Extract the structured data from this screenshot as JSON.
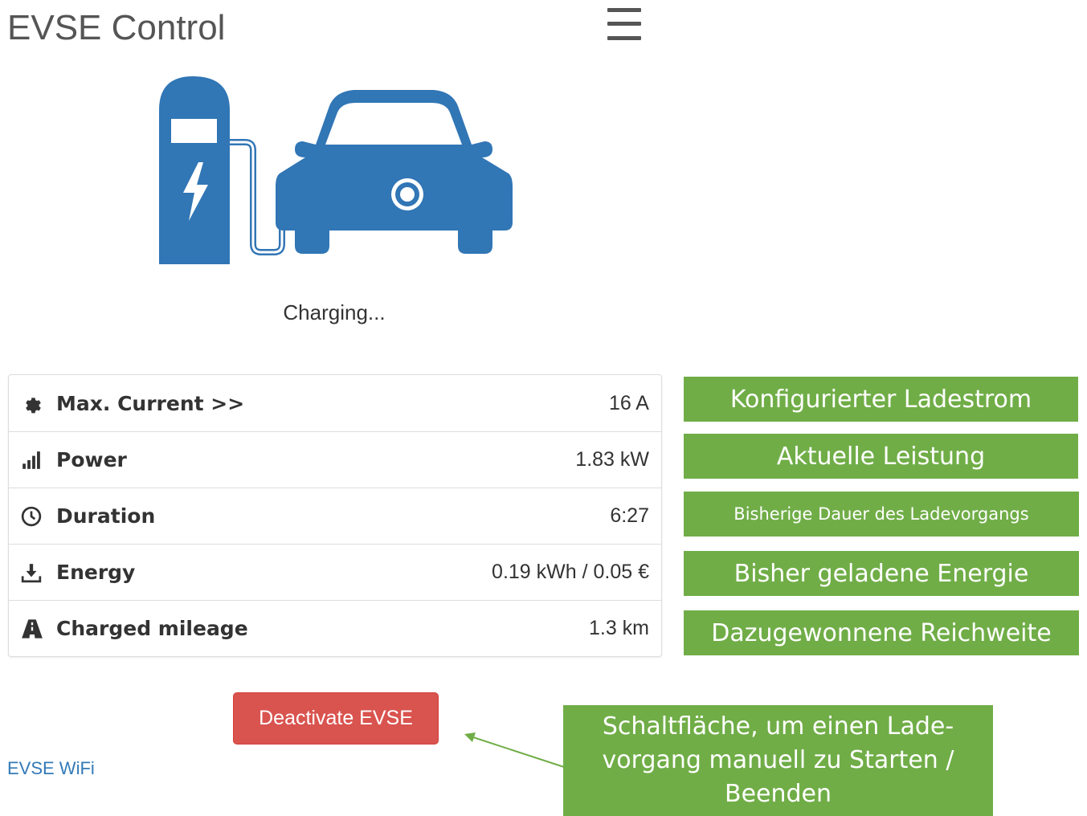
{
  "header": {
    "title": "EVSE Control"
  },
  "status": {
    "text": "Charging..."
  },
  "metrics": [
    {
      "label": "Max. Current >>",
      "value": "16 A",
      "icon": "gear-icon"
    },
    {
      "label": "Power",
      "value": "1.83 kW",
      "icon": "signal-bars-icon"
    },
    {
      "label": "Duration",
      "value": "6:27",
      "icon": "clock-icon"
    },
    {
      "label": "Energy",
      "value": "0.19 kWh / 0.05 €",
      "icon": "download-icon"
    },
    {
      "label": "Charged mileage",
      "value": "1.3 km",
      "icon": "road-icon"
    }
  ],
  "annotations": {
    "max_current": "Konfigurierter Ladestrom",
    "power": "Aktuelle Leistung",
    "duration": "Bisherige Dauer des Ladevorgangs",
    "energy": "Bisher geladene Energie",
    "mileage": "Dazugewonnene Reichweite",
    "button_line1": "Schaltfläche, um einen Lade-",
    "button_line2": "vorgang manuell zu Starten /",
    "button_line3": "Beenden"
  },
  "actions": {
    "deactivate_label": "Deactivate EVSE"
  },
  "footer": {
    "link": "EVSE WiFi"
  },
  "colors": {
    "hero_blue": "#3176b5",
    "annotation_green": "#70ad47",
    "danger_red": "#d9534f",
    "link_blue": "#337ab7"
  }
}
